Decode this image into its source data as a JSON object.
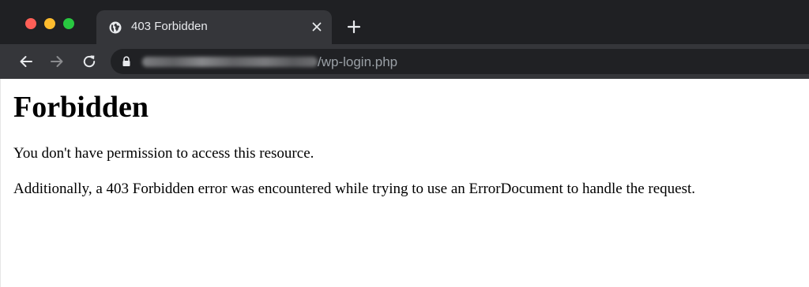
{
  "window": {
    "traffic_colors": {
      "close": "#ff5f57",
      "minimize": "#febc2e",
      "zoom": "#28c840"
    }
  },
  "tab": {
    "title": "403 Forbidden",
    "favicon": "globe-icon"
  },
  "toolbar": {
    "url_path": "/wp-login.php",
    "icons": [
      "back-arrow-icon",
      "forward-arrow-icon",
      "reload-icon",
      "lock-icon"
    ]
  },
  "page": {
    "heading": "Forbidden",
    "paragraph_1": "You don't have permission to access this resource.",
    "paragraph_2": "Additionally, a 403 Forbidden error was encountered while trying to use an ErrorDocument to handle the request."
  }
}
